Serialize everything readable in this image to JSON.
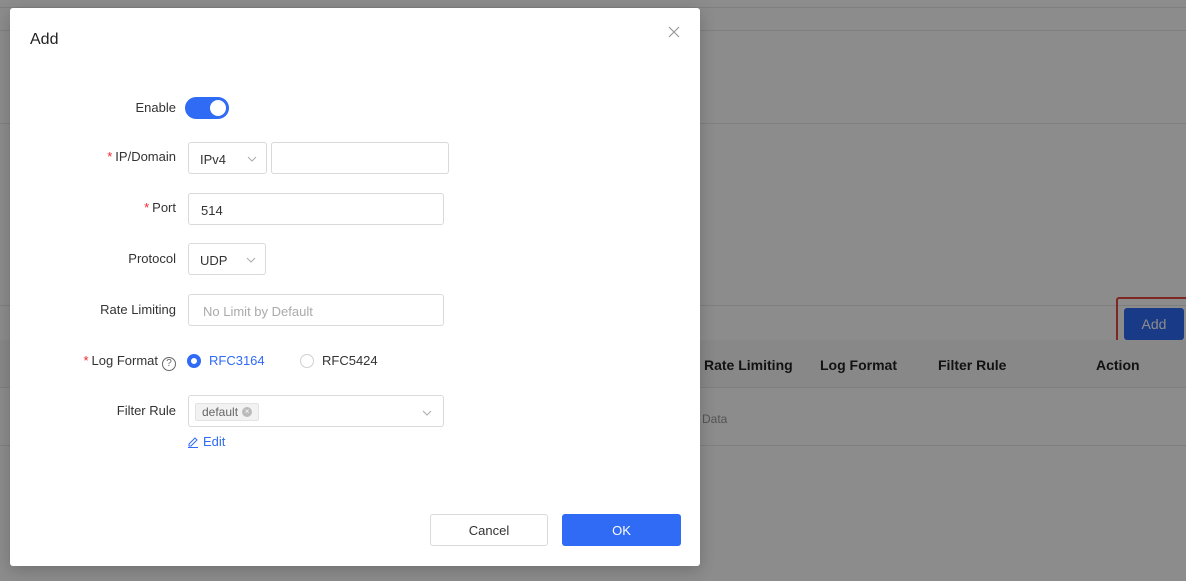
{
  "background": {
    "add_button_label": "Add",
    "table_headers": [
      "Rate Limiting",
      "Log Format",
      "Filter Rule",
      "Action"
    ],
    "empty_text": "Data"
  },
  "modal": {
    "title": "Add",
    "close_icon": "close-icon",
    "enable": {
      "label": "Enable",
      "value": true
    },
    "ip_domain": {
      "label": "IP/Domain",
      "type_value": "IPv4",
      "value": ""
    },
    "port": {
      "label": "Port",
      "value": "514"
    },
    "protocol": {
      "label": "Protocol",
      "value": "UDP"
    },
    "rate_limiting": {
      "label": "Rate Limiting",
      "placeholder": "No Limit by Default",
      "value": ""
    },
    "log_format": {
      "label": "Log Format",
      "help_icon": "?",
      "options": [
        "RFC3164",
        "RFC5424"
      ],
      "selected": "RFC3164"
    },
    "filter_rule": {
      "label": "Filter Rule",
      "tags": [
        "default"
      ]
    },
    "edit_label": "Edit",
    "cancel_label": "Cancel",
    "ok_label": "OK"
  },
  "colors": {
    "primary": "#2f6bf5",
    "required": "#f5222d",
    "highlight": "#e8473c"
  }
}
